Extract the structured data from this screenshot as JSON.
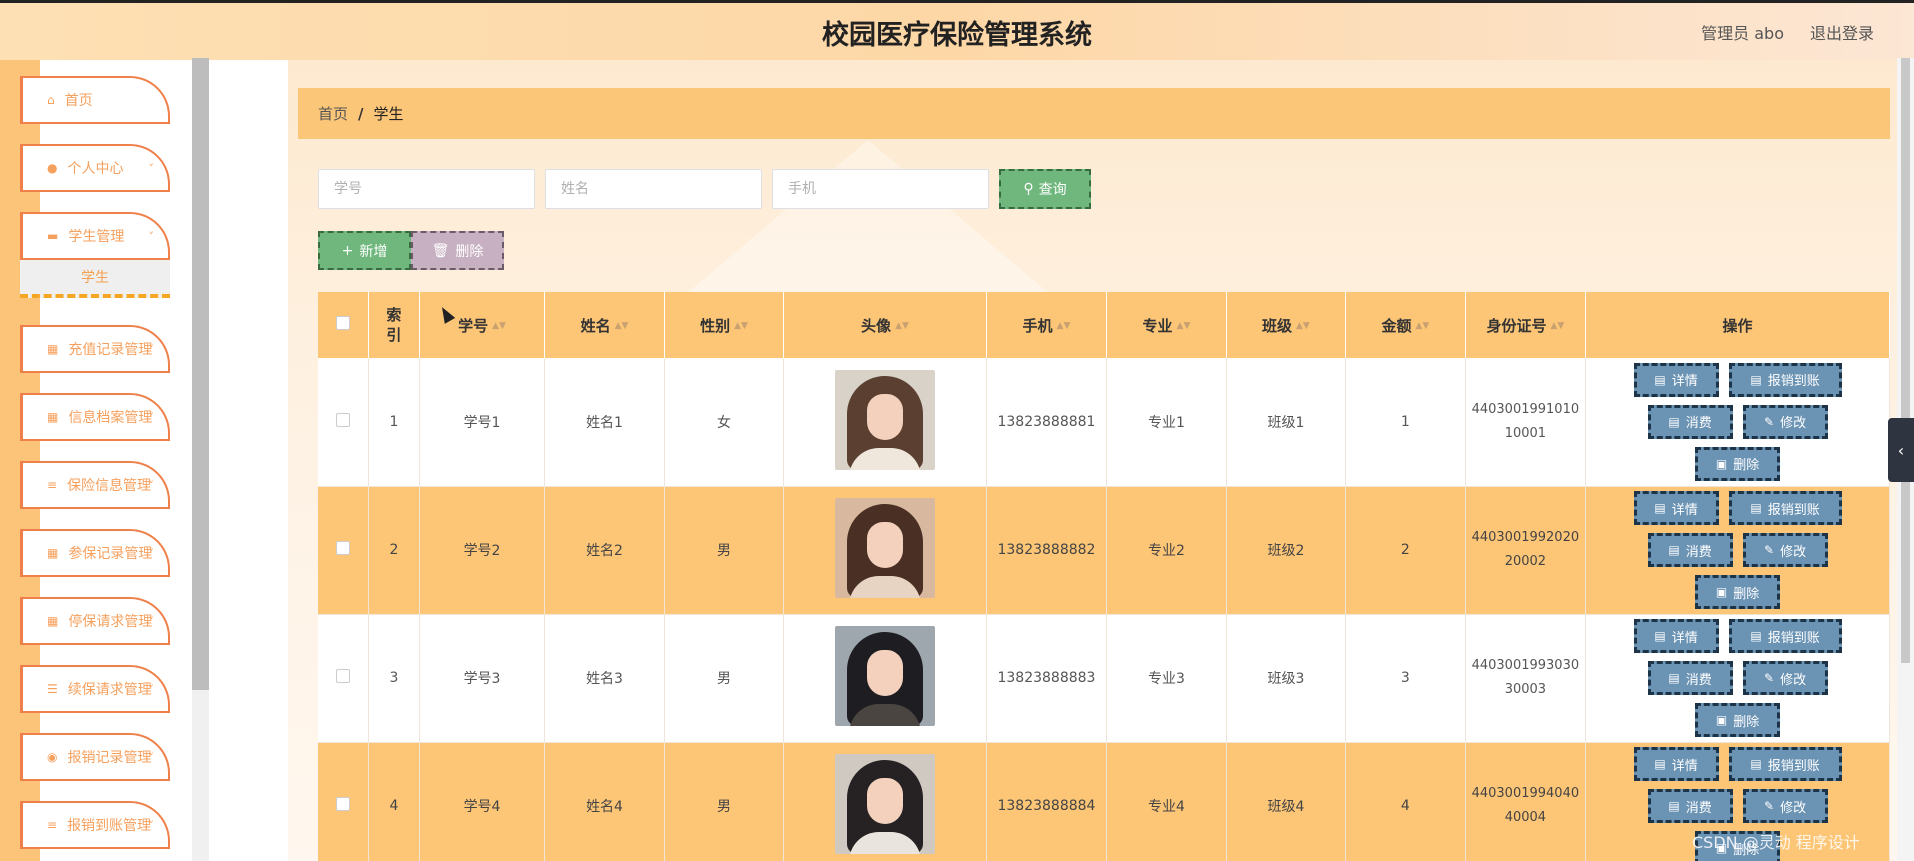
{
  "header": {
    "title": "校园医疗保险管理系统",
    "user_label": "管理员 abo",
    "logout_label": "退出登录"
  },
  "sidebar": {
    "items": [
      {
        "label": "首页",
        "icon": "home-icon",
        "has_arrow": false
      },
      {
        "label": "个人中心",
        "icon": "user-icon",
        "has_arrow": true
      },
      {
        "label": "学生管理",
        "icon": "monitor-icon",
        "has_arrow": true
      },
      {
        "label": "充值记录管理",
        "icon": "grid-icon",
        "has_arrow": true
      },
      {
        "label": "信息档案管理",
        "icon": "grid-icon",
        "has_arrow": true
      },
      {
        "label": "保险信息管理",
        "icon": "list-icon",
        "has_arrow": true
      },
      {
        "label": "参保记录管理",
        "icon": "grid-icon",
        "has_arrow": true
      },
      {
        "label": "停保请求管理",
        "icon": "grid-icon",
        "has_arrow": true
      },
      {
        "label": "续保请求管理",
        "icon": "sliders-icon",
        "has_arrow": true
      },
      {
        "label": "报销记录管理",
        "icon": "pin-icon",
        "has_arrow": true
      },
      {
        "label": "报销到账管理",
        "icon": "list-icon",
        "has_arrow": true
      }
    ],
    "active_sub_item": "学生"
  },
  "breadcrumb": {
    "home": "首页",
    "separator": "/",
    "current": "学生"
  },
  "search": {
    "student_id_placeholder": "学号",
    "name_placeholder": "姓名",
    "phone_placeholder": "手机",
    "search_label": "查询"
  },
  "actions": {
    "add_label": "新增",
    "delete_label": "删除"
  },
  "table": {
    "headers": {
      "index": "索引",
      "student_id": "学号",
      "name": "姓名",
      "gender": "性别",
      "avatar": "头像",
      "phone": "手机",
      "major": "专业",
      "class": "班级",
      "amount": "金额",
      "id_card": "身份证号",
      "ops": "操作"
    },
    "rows": [
      {
        "index": "1",
        "student_id": "学号1",
        "name": "姓名1",
        "gender": "女",
        "phone": "13823888881",
        "major": "专业1",
        "class": "班级1",
        "amount": "1",
        "id_card_1": "4403001991010",
        "id_card_2": "10001"
      },
      {
        "index": "2",
        "student_id": "学号2",
        "name": "姓名2",
        "gender": "男",
        "phone": "13823888882",
        "major": "专业2",
        "class": "班级2",
        "amount": "2",
        "id_card_1": "4403001992020",
        "id_card_2": "20002"
      },
      {
        "index": "3",
        "student_id": "学号3",
        "name": "姓名3",
        "gender": "男",
        "phone": "13823888883",
        "major": "专业3",
        "class": "班级3",
        "amount": "3",
        "id_card_1": "4403001993030",
        "id_card_2": "30003"
      },
      {
        "index": "4",
        "student_id": "学号4",
        "name": "姓名4",
        "gender": "男",
        "phone": "13823888884",
        "major": "专业4",
        "class": "班级4",
        "amount": "4",
        "id_card_1": "4403001994040",
        "id_card_2": "40004"
      }
    ],
    "row_buttons": {
      "detail": "详情",
      "reimburse": "报销到账",
      "consume": "消费",
      "edit": "修改",
      "delete": "删除"
    }
  },
  "watermark": "CSDN @灵动 程序设计",
  "colors": {
    "accent_orange": "#fdc677",
    "menu_border": "#f0804a",
    "search_green": "#6fb77c",
    "op_blue": "#6b93b4"
  }
}
